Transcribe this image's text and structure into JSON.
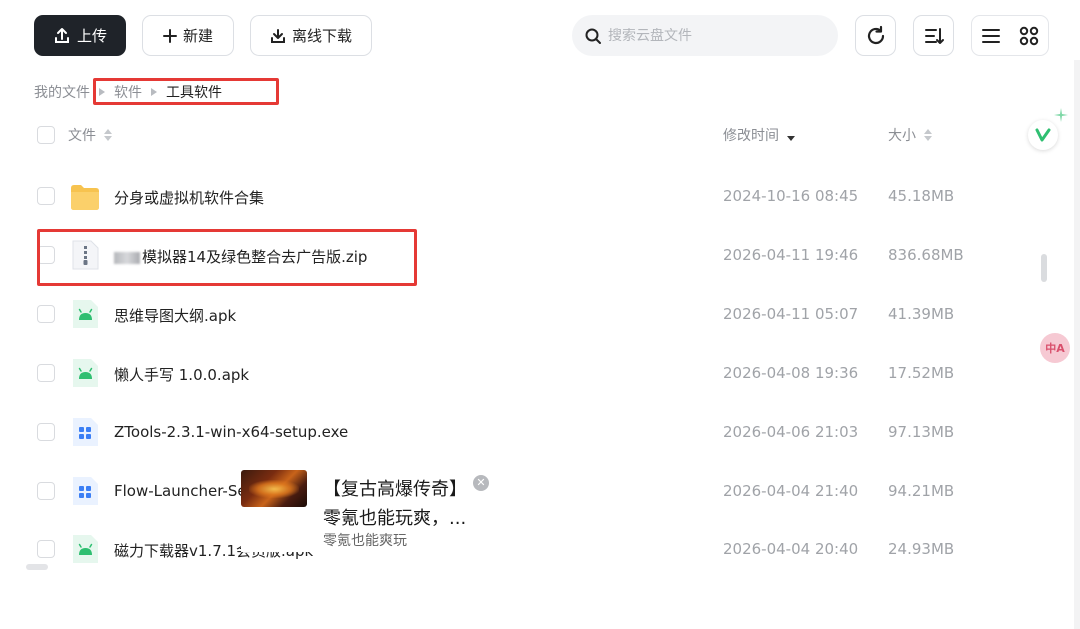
{
  "toolbar": {
    "upload_label": "上传",
    "new_label": "新建",
    "offline_label": "离线下载",
    "search_placeholder": "搜索云盘文件"
  },
  "breadcrumb": [
    "我的文件",
    "软件",
    "工具软件"
  ],
  "table": {
    "headers": {
      "name": "文件",
      "modified": "修改时间",
      "size": "大小"
    },
    "rows": [
      {
        "name": "分身或虚拟机软件合集",
        "time": "2024-10-16 08:45",
        "size": "45.18MB",
        "type": "folder-icon"
      },
      {
        "name": "模拟器14及绿色整合去广告版.zip",
        "time": "2026-04-11 19:46",
        "size": "836.68MB",
        "type": "zip-icon"
      },
      {
        "name": "思维导图大纲.apk",
        "time": "2026-04-11 05:07",
        "size": "41.39MB",
        "type": "apk-icon"
      },
      {
        "name": "懒人手写 1.0.0.apk",
        "time": "2026-04-08 19:36",
        "size": "17.52MB",
        "type": "apk-icon"
      },
      {
        "name": "ZTools-2.3.1-win-x64-setup.exe",
        "time": "2026-04-06 21:03",
        "size": "97.13MB",
        "type": "exe-icon"
      },
      {
        "name": "Flow-Launcher-Set",
        "time": "2026-04-04 21:40",
        "size": "94.21MB",
        "type": "exe-icon"
      },
      {
        "name": "磁力下载器v1.7.1会员版.apk",
        "time": "2026-04-04 20:40",
        "size": "24.93MB",
        "type": "apk-icon"
      }
    ]
  },
  "ad": {
    "title": "【复古高爆传奇】",
    "subtitle": "零氪也能玩爽，...",
    "source": "零氪也能爽玩",
    "close": "✕"
  },
  "side_badge": {
    "translate": "中A"
  },
  "colors": {
    "accent_dark": "#1f2329",
    "highlight_red": "#e53935",
    "folder": "#f7c34f",
    "apk_green": "#2fbf71",
    "exe_blue": "#3b7ff5"
  }
}
